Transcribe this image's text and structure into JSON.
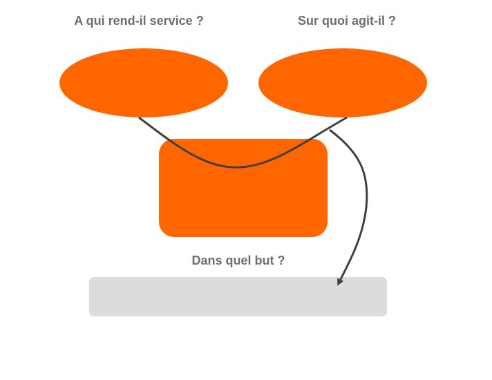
{
  "labels": {
    "left_question": "A qui rend-il service ?",
    "right_question": "Sur quoi agit-il ?",
    "bottom_question": "Dans quel but ?"
  },
  "colors": {
    "shape_fill": "#ff6600",
    "connector": "#404040",
    "goal_box": "#dcdcdc",
    "label_text": "#6e6e6e"
  }
}
